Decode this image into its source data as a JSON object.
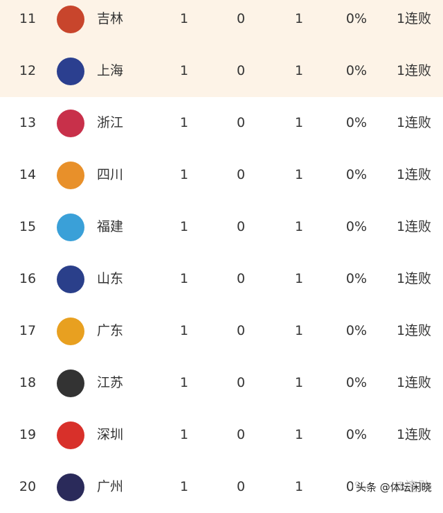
{
  "standings": [
    {
      "rank": "11",
      "team": "吉林",
      "logo": "jilin-logo",
      "logo_color": "#c8452c",
      "w": "1",
      "l": "0",
      "g": "1",
      "pct": "0%",
      "streak": "1连败",
      "highlight": true
    },
    {
      "rank": "12",
      "team": "上海",
      "logo": "shanghai-logo",
      "logo_color": "#2b3f8f",
      "w": "1",
      "l": "0",
      "g": "1",
      "pct": "0%",
      "streak": "1连败",
      "highlight": true
    },
    {
      "rank": "13",
      "team": "浙江",
      "logo": "zhejiang-logo",
      "logo_color": "#c8304a",
      "w": "1",
      "l": "0",
      "g": "1",
      "pct": "0%",
      "streak": "1连败"
    },
    {
      "rank": "14",
      "team": "四川",
      "logo": "sichuan-logo",
      "logo_color": "#e8902a",
      "w": "1",
      "l": "0",
      "g": "1",
      "pct": "0%",
      "streak": "1连败"
    },
    {
      "rank": "15",
      "team": "福建",
      "logo": "fujian-logo",
      "logo_color": "#3aa0d8",
      "w": "1",
      "l": "0",
      "g": "1",
      "pct": "0%",
      "streak": "1连败"
    },
    {
      "rank": "16",
      "team": "山东",
      "logo": "shandong-logo",
      "logo_color": "#2a3f8a",
      "w": "1",
      "l": "0",
      "g": "1",
      "pct": "0%",
      "streak": "1连败"
    },
    {
      "rank": "17",
      "team": "广东",
      "logo": "guangdong-logo",
      "logo_color": "#e8a020",
      "w": "1",
      "l": "0",
      "g": "1",
      "pct": "0%",
      "streak": "1连败"
    },
    {
      "rank": "18",
      "team": "江苏",
      "logo": "jiangsu-logo",
      "logo_color": "#333333",
      "w": "1",
      "l": "0",
      "g": "1",
      "pct": "0%",
      "streak": "1连败"
    },
    {
      "rank": "19",
      "team": "深圳",
      "logo": "shenzhen-logo",
      "logo_color": "#d8302a",
      "w": "1",
      "l": "0",
      "g": "1",
      "pct": "0%",
      "streak": "1连败"
    },
    {
      "rank": "20",
      "team": "广州",
      "logo": "guangzhou-logo",
      "logo_color": "#2a2a5a",
      "w": "1",
      "l": "0",
      "g": "1",
      "pct": "0%",
      "streak": "1连败"
    }
  ],
  "watermark": "头条 @体坛闲晓"
}
